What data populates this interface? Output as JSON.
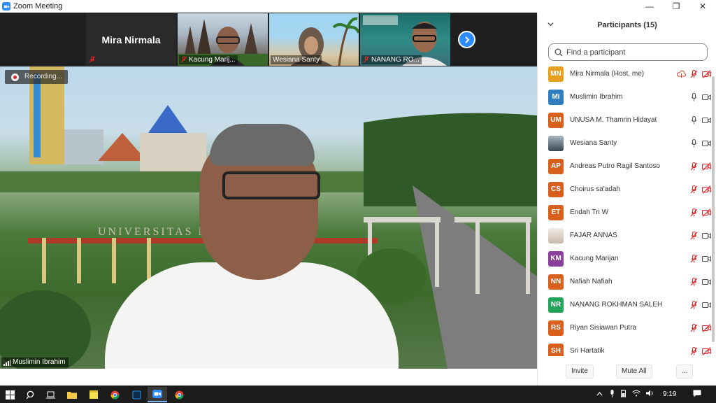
{
  "window": {
    "title": "Zoom Meeting",
    "minimize": "—",
    "restore": "❐",
    "close": "✕"
  },
  "strip": {
    "tiles": [
      {
        "name": "Mira Nirmala",
        "type": "name-only"
      },
      {
        "name": "Kacung Marij...",
        "type": "video"
      },
      {
        "name": "Wesiana Santy",
        "type": "video"
      },
      {
        "name": "NANANG RO...",
        "type": "video"
      }
    ]
  },
  "main_video": {
    "recording_label": "Recording...",
    "speaker_name": "Muslimin Ibrahim",
    "background_text": "UNIVERSITAS NEG           YA"
  },
  "participants_panel": {
    "title": "Participants (15)",
    "search_placeholder": "Find a participant",
    "participants": [
      {
        "initials": "MN",
        "name": "Mira Nirmala (Host, me)",
        "color": "#e8a020",
        "mic": "muted",
        "video": "off",
        "share_icon": true
      },
      {
        "initials": "MI",
        "name": "Muslimin Ibrahim",
        "color": "#2f7fc0",
        "mic": "on",
        "video": "on"
      },
      {
        "initials": "UM",
        "name": "UNUSA M. Thamrin Hidayat",
        "color": "#d9601c",
        "mic": "on",
        "video": "on"
      },
      {
        "initials": "",
        "name": "Wesiana Santy",
        "color": "#7f8c96",
        "mic": "on",
        "video": "on",
        "photo": true
      },
      {
        "initials": "AP",
        "name": "Andreas Putro Ragil Santoso",
        "color": "#d9601c",
        "mic": "muted",
        "video": "off"
      },
      {
        "initials": "CS",
        "name": "Choirus sa'adah",
        "color": "#d9601c",
        "mic": "muted",
        "video": "off"
      },
      {
        "initials": "ET",
        "name": "Endah Tri W",
        "color": "#d9601c",
        "mic": "muted",
        "video": "off"
      },
      {
        "initials": "",
        "name": "FAJAR ANNAS",
        "color": "#c9c9c9",
        "mic": "muted",
        "video": "on",
        "photo": true
      },
      {
        "initials": "KM",
        "name": "Kacung Marijan",
        "color": "#8a3f9c",
        "mic": "muted",
        "video": "on"
      },
      {
        "initials": "NN",
        "name": "Nafiah Nafiah",
        "color": "#d9601c",
        "mic": "muted",
        "video": "on"
      },
      {
        "initials": "NR",
        "name": "NANANG ROKHMAN SALEH",
        "color": "#21a35a",
        "mic": "muted",
        "video": "on"
      },
      {
        "initials": "RS",
        "name": "Riyan Sisiawan Putra",
        "color": "#d9601c",
        "mic": "muted",
        "video": "off"
      },
      {
        "initials": "SH",
        "name": "Sri Hartatik",
        "color": "#d9601c",
        "mic": "muted",
        "video": "off"
      }
    ],
    "footer": {
      "invite": "Invite",
      "mute_all": "Mute All",
      "more": "..."
    }
  },
  "taskbar": {
    "time": "9:19"
  },
  "colors": {
    "accent": "#2d8cff",
    "muted_red": "#e02828"
  }
}
